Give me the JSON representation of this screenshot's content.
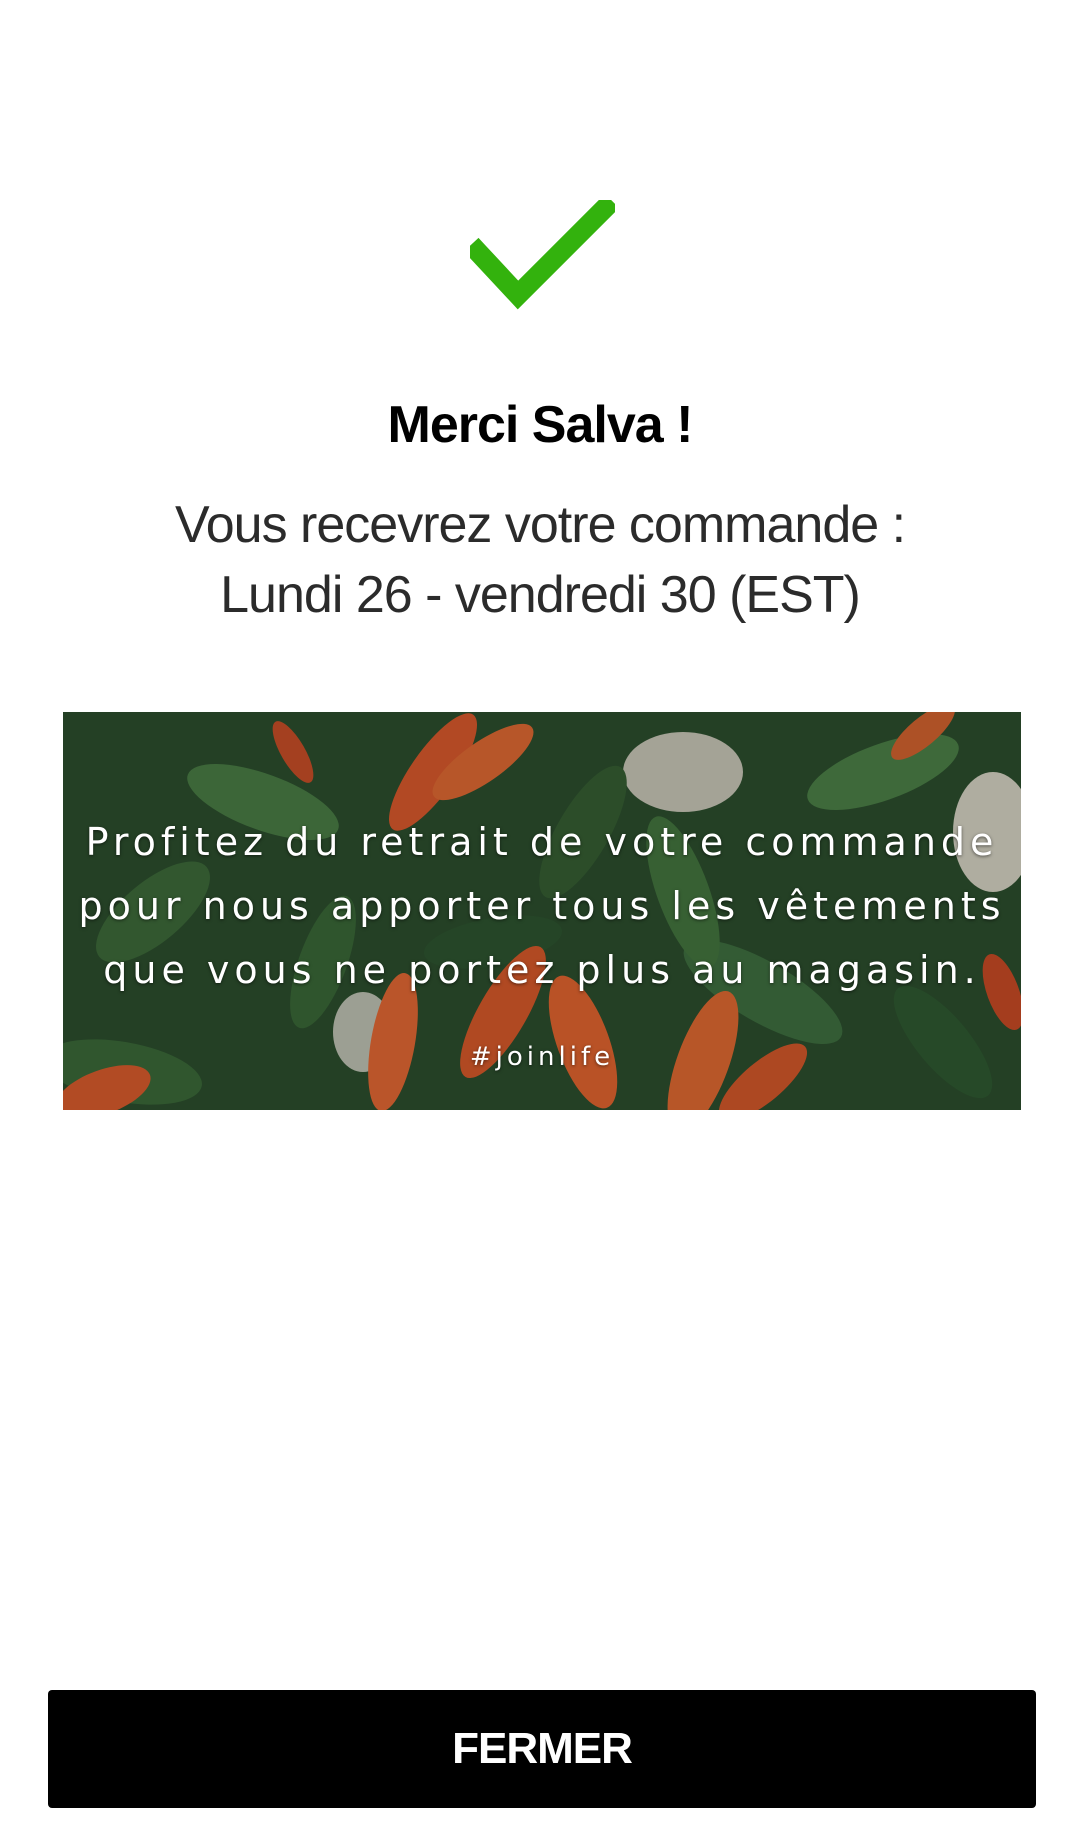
{
  "confirmation": {
    "icon": "checkmark-icon",
    "icon_color": "#33b20d",
    "title": "Merci Salva !",
    "delivery_line1": "Vous recevrez votre commande :",
    "delivery_line2": "Lundi 26 - vendredi 30 (EST)"
  },
  "banner": {
    "line1": "Profitez du retrait de votre commande",
    "line2": "pour nous apporter tous les vêtements",
    "line3": "que vous ne portez plus au magasin.",
    "hashtag": "#joinlife"
  },
  "footer": {
    "close_label": "FERMER"
  }
}
